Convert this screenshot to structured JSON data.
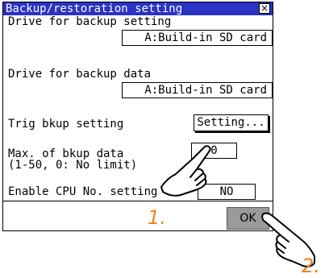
{
  "dialog": {
    "title": "Backup/restoration setting",
    "close_glyph": "×"
  },
  "drive_backup_setting": {
    "label": "Drive for backup setting",
    "value": "A:Build-in SD card"
  },
  "drive_backup_data": {
    "label": "Drive for backup data",
    "value": "A:Build-in SD card"
  },
  "trig_backup": {
    "label": "Trig bkup setting",
    "button_label": "Setting..."
  },
  "max_backup": {
    "label_line1": "Max. of bkup data",
    "label_line2": "(1-50, 0: No limit)",
    "value": "0"
  },
  "cpu_no": {
    "label": "Enable CPU No. setting",
    "value": "NO"
  },
  "ok_button": {
    "label": "OK"
  },
  "annotations": {
    "step1": "1.",
    "step2": "2."
  },
  "colors": {
    "titlebar": "#2a33c4",
    "ok_button": "#9a9a9a",
    "step_marker": "#f0821e"
  }
}
